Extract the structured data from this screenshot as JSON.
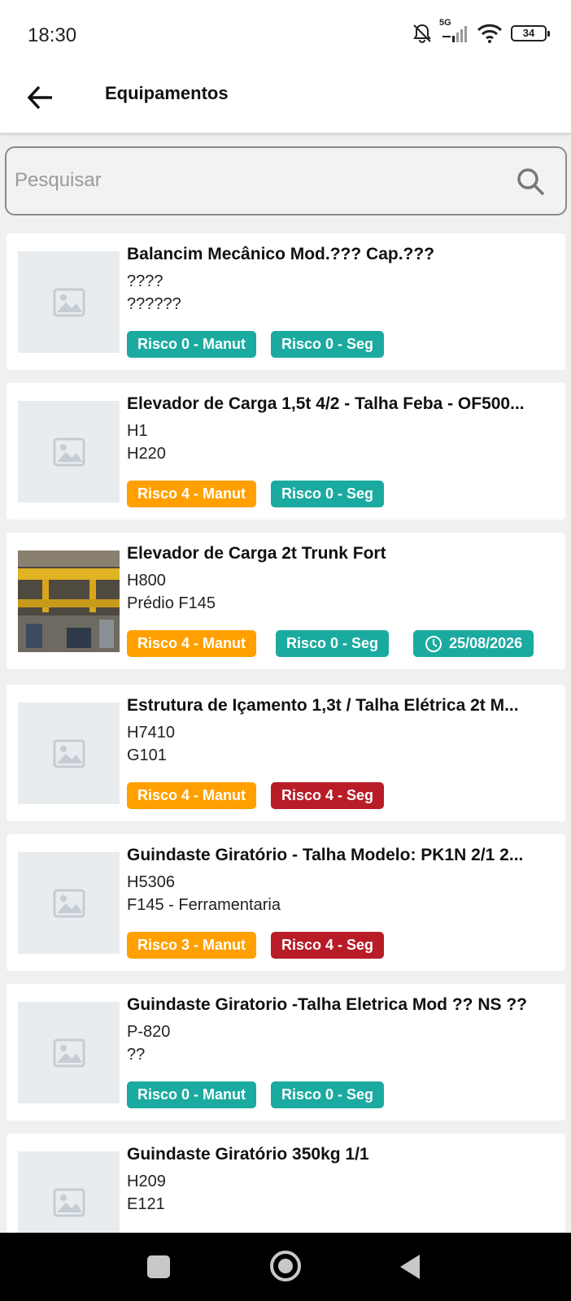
{
  "status_bar": {
    "time": "18:30",
    "network": "5G",
    "battery": "34",
    "icons": [
      "bell-off-icon",
      "signal-icon",
      "wifi-icon",
      "battery-icon"
    ]
  },
  "app_bar": {
    "title": "Equipamentos",
    "back_icon": "arrow-left-icon"
  },
  "search": {
    "placeholder": "Pesquisar",
    "value": "",
    "icon": "search-icon"
  },
  "equipment": [
    {
      "title": "Balancim Mecânico Mod.??? Cap.???",
      "line1": "????",
      "line2": "??????",
      "image": "placeholder",
      "badges": [
        {
          "label": "Risco 0 - Manut",
          "color": "#1baaa0"
        },
        {
          "label": "Risco 0 - Seg",
          "color": "#1baaa0"
        }
      ]
    },
    {
      "title": "Elevador de Carga 1,5t 4/2 - Talha Feba - OF500...",
      "line1": "H1",
      "line2": "H220",
      "image": "placeholder",
      "badges": [
        {
          "label": "Risco 4 - Manut",
          "color": "#ffa000"
        },
        {
          "label": "Risco 0 - Seg",
          "color": "#1baaa0"
        }
      ]
    },
    {
      "title": "Elevador de Carga 2t Trunk Fort",
      "line1": "H800",
      "line2": "Prédio F145",
      "image": "photo",
      "badges": [
        {
          "label": "Risco 4 - Manut",
          "color": "#ffa000"
        },
        {
          "label": "Risco 0 - Seg",
          "color": "#1baaa0"
        }
      ],
      "date_badge": {
        "label": "25/08/2026",
        "icon": "clock-icon",
        "color": "#1baaa0"
      }
    },
    {
      "title": "Estrutura de Içamento 1,3t / Talha Elétrica 2t M...",
      "line1": "H7410",
      "line2": "G101",
      "image": "placeholder",
      "badges": [
        {
          "label": "Risco 4 - Manut",
          "color": "#ffa000"
        },
        {
          "label": "Risco 4 - Seg",
          "color": "#b71c27"
        }
      ]
    },
    {
      "title": "Guindaste Giratório - Talha Modelo: PK1N 2/1 2...",
      "line1": "H5306",
      "line2": "F145 - Ferramentaria",
      "image": "placeholder",
      "badges": [
        {
          "label": "Risco 3 - Manut",
          "color": "#ffa000"
        },
        {
          "label": "Risco 4 - Seg",
          "color": "#b71c27"
        }
      ]
    },
    {
      "title": "Guindaste Giratorio -Talha Eletrica Mod ??  NS ??",
      "line1": "P-820",
      "line2": "??",
      "image": "placeholder",
      "badges": [
        {
          "label": "Risco 0 - Manut",
          "color": "#1baaa0"
        },
        {
          "label": "Risco 0 - Seg",
          "color": "#1baaa0"
        }
      ]
    },
    {
      "title": "Guindaste Giratório 350kg 1/1",
      "line1": "H209",
      "line2": "E121",
      "image": "placeholder",
      "badges": []
    }
  ],
  "nav_bar": {
    "icons": [
      "recent-apps-icon",
      "home-icon",
      "back-icon"
    ]
  }
}
